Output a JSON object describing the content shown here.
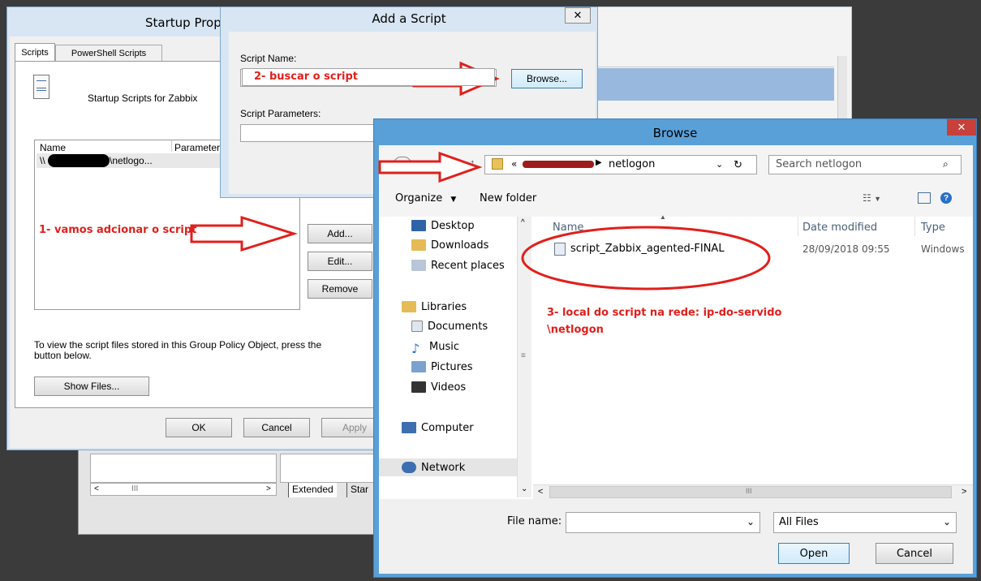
{
  "startup_dialog": {
    "title": "Startup Prop",
    "tabs": [
      "Scripts",
      "PowerShell Scripts"
    ],
    "header_label": "Startup Scripts for Zabbix",
    "columns": [
      "Name",
      "Parameters"
    ],
    "row": {
      "prefix": "\\\\",
      "suffix": "\\netlogo..."
    },
    "buttons": {
      "add": "Add...",
      "edit": "Edit...",
      "remove": "Remove"
    },
    "info_text": "To view the script files stored in this Group Policy Object, press the button below.",
    "show_files": "Show Files...",
    "ok": "OK",
    "cancel": "Cancel",
    "apply": "Apply"
  },
  "add_script": {
    "title": "Add a Script",
    "script_name_label": "Script Name:",
    "browse": "Browse...",
    "params_label": "Script Parameters:"
  },
  "browse": {
    "title": "Browse",
    "breadcrumb_prefix": "«",
    "breadcrumb_current": "netlogon",
    "search_placeholder": "Search netlogon",
    "organize": "Organize",
    "new_folder": "New folder",
    "nav": {
      "favorites": [
        "Desktop",
        "Downloads",
        "Recent places"
      ],
      "libraries_label": "Libraries",
      "libraries": [
        "Documents",
        "Music",
        "Pictures",
        "Videos"
      ],
      "computer": "Computer",
      "network": "Network"
    },
    "columns": {
      "name": "Name",
      "date": "Date modified",
      "type": "Type"
    },
    "files": [
      {
        "name": "script_Zabbix_agented-FINAL",
        "date": "28/09/2018 09:55",
        "type": "Windows"
      }
    ],
    "filename_label": "File name:",
    "filter": "All Files",
    "open": "Open",
    "cancel": "Cancel"
  },
  "background": {
    "extended_tab": "Extended",
    "standard_tab": "Star"
  },
  "annotations": {
    "step1": "1- vamos adcionar o script",
    "step2": "2- buscar o script",
    "step3_line1": "3- local do script na rede: ip-do-servido",
    "step3_line2": "\\netlogon"
  },
  "colors": {
    "annotation": "#e0201c",
    "window_border": "#5a9fd4",
    "dialog_bg": "#f0f0f0"
  }
}
